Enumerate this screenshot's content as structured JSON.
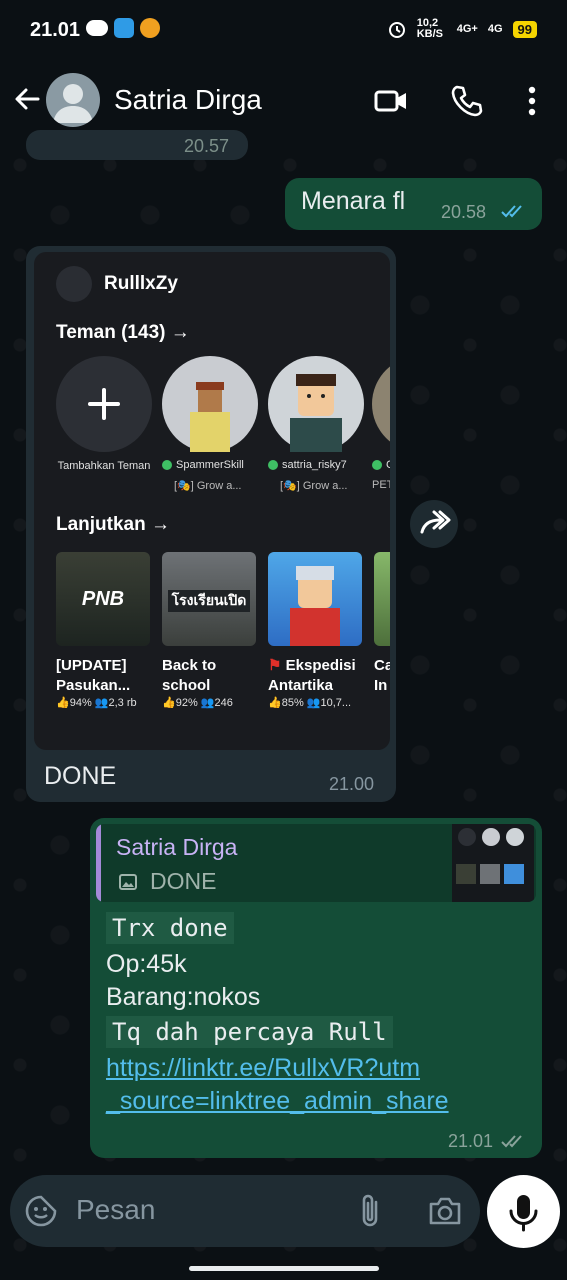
{
  "status_bar": {
    "time": "21.01",
    "net_speed": "10,2 KB/S",
    "signal1": "4G+",
    "signal2": "4G",
    "battery": "99"
  },
  "header": {
    "contact_name": "Satria Dirga"
  },
  "messages": {
    "partial_time": "20.57",
    "out1": {
      "text": "Menara fl",
      "time": "20.58"
    },
    "in1": {
      "screenshot": {
        "username": "RulllxZy",
        "friends_heading": "Teman (143) →",
        "add_friend": "Tambahkan Teman",
        "friends": [
          {
            "name": "SpammerSkill",
            "status": "[🎭] Grow a..."
          },
          {
            "name": "sattria_risky7",
            "status": "[🎭] Grow a..."
          },
          {
            "name": "C",
            "status": "PET"
          }
        ],
        "continue_heading": "Lanjutkan →",
        "games": [
          {
            "title": "[UPDATE] Pasukan...",
            "rating": "94%",
            "players": "2,3 rb",
            "thumb": "PNB"
          },
          {
            "title": "Back to school",
            "rating": "92%",
            "players": "246",
            "thumb": "โรงเรียนเปิด"
          },
          {
            "title": "Ekspedisi Antartika",
            "rating": "85%",
            "players": "10,7...",
            "thumb": ""
          },
          {
            "title": "Ca In",
            "rating": "",
            "players": "",
            "thumb": ""
          }
        ]
      },
      "text": "DONE",
      "time": "21.00"
    },
    "out2": {
      "quote_name": "Satria Dirga",
      "quote_text": "DONE",
      "line1": "Trx done",
      "line2": "Op:45k",
      "line3": "Barang:nokos",
      "line4": "Tq dah percaya Rull",
      "link_line1": "https://linktr.ee/RullxVR?utm",
      "link_line2": "_source=linktree_admin_share",
      "time": "21.01"
    }
  },
  "input": {
    "placeholder": "Pesan"
  },
  "colors": {
    "incoming": "#202c33",
    "outgoing": "#144d37",
    "link": "#53bdeb",
    "tick": "#53bdeb"
  }
}
